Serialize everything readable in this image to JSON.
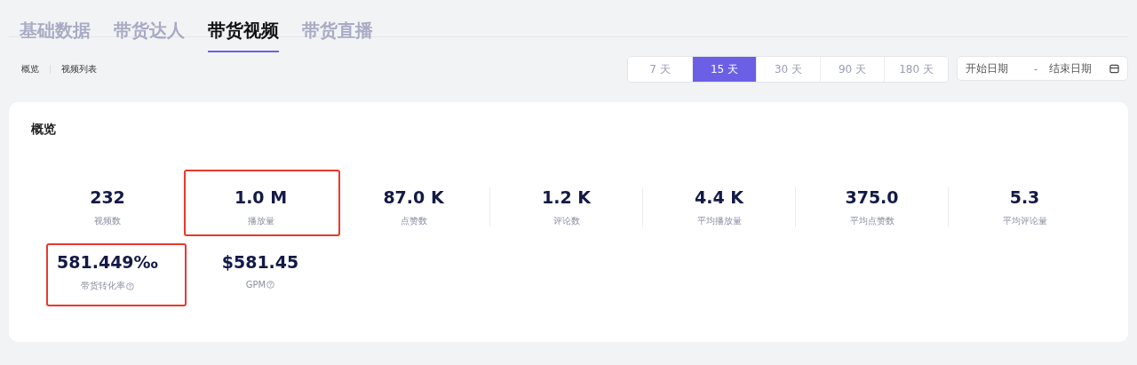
{
  "tabs": [
    {
      "label": "基础数据",
      "selected": false
    },
    {
      "label": "带货达人",
      "selected": false
    },
    {
      "label": "带货视频",
      "selected": true
    },
    {
      "label": "带货直播",
      "selected": false
    }
  ],
  "sub_nav": [
    {
      "label": "概览"
    },
    {
      "label": "视频列表"
    }
  ],
  "ranges": [
    {
      "label": "7 天",
      "selected": false
    },
    {
      "label": "15 天",
      "selected": true
    },
    {
      "label": "30 天",
      "selected": false
    },
    {
      "label": "90 天",
      "selected": false
    },
    {
      "label": "180 天",
      "selected": false
    }
  ],
  "date_range": {
    "start_placeholder": "开始日期",
    "separator": "-",
    "end_placeholder": "结束日期"
  },
  "overview": {
    "title": "概览",
    "metrics": [
      {
        "value": "232",
        "label": "视频数",
        "help": false,
        "highlighted": false
      },
      {
        "value": "1.0 M",
        "label": "播放量",
        "help": false,
        "highlighted": true
      },
      {
        "value": "87.0 K",
        "label": "点赞数",
        "help": false,
        "highlighted": false
      },
      {
        "value": "1.2 K",
        "label": "评论数",
        "help": false,
        "highlighted": false
      },
      {
        "value": "4.4 K",
        "label": "平均播放量",
        "help": false,
        "highlighted": false
      },
      {
        "value": "375.0",
        "label": "平均点赞数",
        "help": false,
        "highlighted": false
      },
      {
        "value": "5.3",
        "label": "平均评论量",
        "help": false,
        "highlighted": false
      },
      {
        "value": "581.449‰",
        "label": "带货转化率",
        "help": true,
        "highlighted": true
      },
      {
        "value": "$581.45",
        "label": "GPM",
        "help": true,
        "highlighted": false
      }
    ]
  }
}
